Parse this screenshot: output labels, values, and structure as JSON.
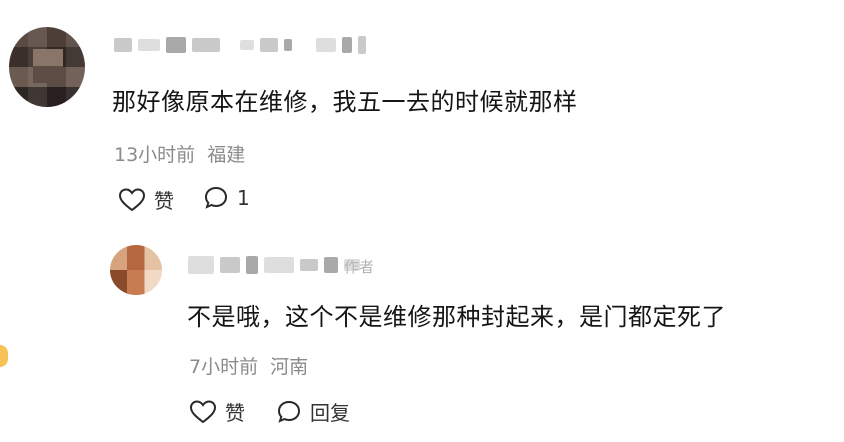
{
  "comment": {
    "text": "那好像原本在维修，我五一去的时候就那样",
    "time": "13小时前",
    "location": "福建",
    "like_label": "赞",
    "reply_count": "1"
  },
  "reply": {
    "author_badge": "作者",
    "text": "不是哦，这个不是维修那种封起来，是门都定死了",
    "time": "7小时前",
    "location": "河南",
    "like_label": "赞",
    "reply_label": "回复"
  },
  "colors": {
    "text": "#151515",
    "meta": "#8b8b8b",
    "background": "#ffffff"
  },
  "icons": {
    "like": "heart-outline",
    "comment": "speech-bubble-outline"
  }
}
